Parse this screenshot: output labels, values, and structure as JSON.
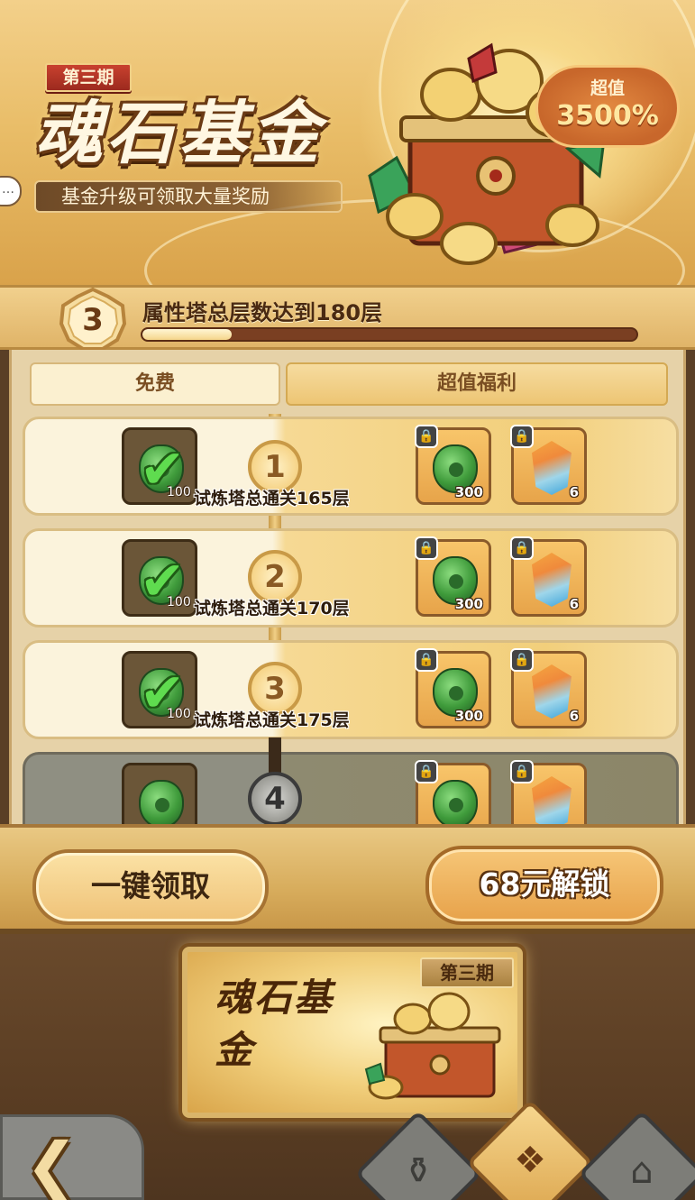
{
  "banner": {
    "period_tag": "第三期",
    "title": "魂石基金",
    "subtitle": "基金升级可领取大量奖励",
    "value_label": "超值",
    "value_percent": "3500%"
  },
  "progress": {
    "level": "3",
    "text": "属性塔总层数达到180层",
    "fill_fraction": 0.18
  },
  "tabs": {
    "free": "免费",
    "premium": "超值福利"
  },
  "rewards": [
    {
      "node": "1",
      "free_qty": "100",
      "label": "试炼塔总通关165层",
      "gem_qty": "300",
      "crystal_qty": "6"
    },
    {
      "node": "2",
      "free_qty": "100",
      "label": "试炼塔总通关170层",
      "gem_qty": "300",
      "crystal_qty": "6"
    },
    {
      "node": "3",
      "free_qty": "100",
      "label": "试炼塔总通关175层",
      "gem_qty": "300",
      "crystal_qty": "6"
    },
    {
      "node": "4"
    }
  ],
  "actions": {
    "claim_all": "一键领取",
    "unlock": "68元解锁"
  },
  "fund_card": {
    "tag": "第三期",
    "title": "魂石基金"
  },
  "colors": {
    "gold": "#f1cf7c",
    "brown": "#5a3d23",
    "accent_green": "#5fdc4f"
  }
}
